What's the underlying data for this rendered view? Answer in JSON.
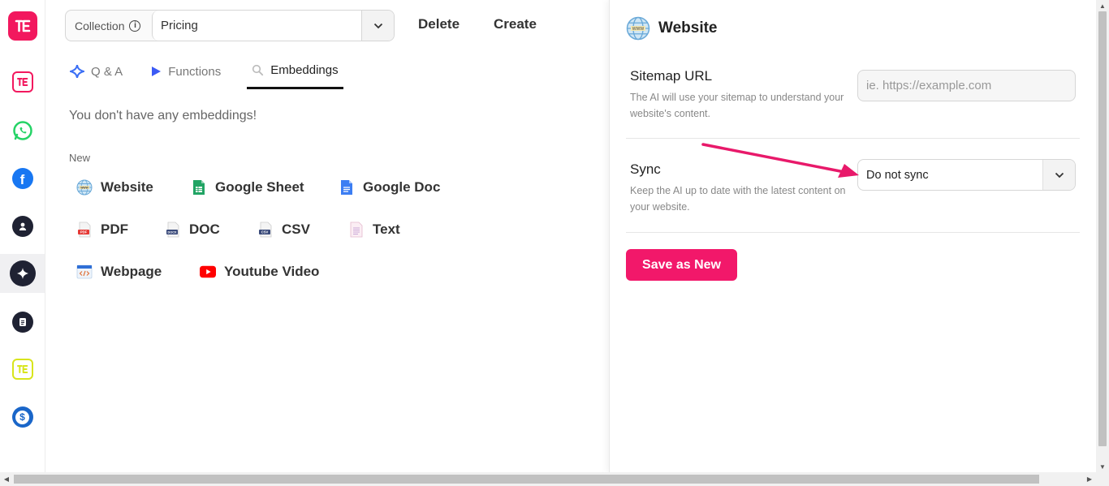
{
  "collection": {
    "label": "Collection",
    "info_icon": "i",
    "value": "Pricing"
  },
  "actions": {
    "delete_label": "Delete",
    "create_label": "Create"
  },
  "tabs": [
    {
      "label": "Q & A",
      "icon": "sparkle-icon"
    },
    {
      "label": "Functions",
      "icon": "play-icon"
    },
    {
      "label": "Embeddings",
      "icon": "search-icon",
      "active": true
    }
  ],
  "embeddings": {
    "empty_message": "You don't have any embeddings!",
    "new_label": "New",
    "sources": [
      {
        "label": "Website",
        "icon": "globe-icon"
      },
      {
        "label": "Google Sheet",
        "icon": "google-sheet-icon"
      },
      {
        "label": "Google Doc",
        "icon": "google-doc-icon"
      },
      {
        "label": "PDF",
        "icon": "pdf-file-icon"
      },
      {
        "label": "DOC",
        "icon": "doc-file-icon"
      },
      {
        "label": "CSV",
        "icon": "csv-file-icon"
      },
      {
        "label": "Text",
        "icon": "text-file-icon"
      },
      {
        "label": "Webpage",
        "icon": "webpage-code-icon"
      },
      {
        "label": "Youtube Video",
        "icon": "youtube-icon"
      }
    ]
  },
  "panel": {
    "title": "Website",
    "sitemap": {
      "label": "Sitemap URL",
      "help": "The AI will use your sitemap to understand your website's content.",
      "placeholder": "ie. https://example.com",
      "value": ""
    },
    "sync": {
      "label": "Sync",
      "help": "Keep the AI up to date with the latest content on your website.",
      "value": "Do not sync"
    },
    "save_label": "Save as New"
  },
  "colors": {
    "brand": "#f2185e",
    "save_button": "#f2186a",
    "annotation_arrow": "#e8196a"
  }
}
